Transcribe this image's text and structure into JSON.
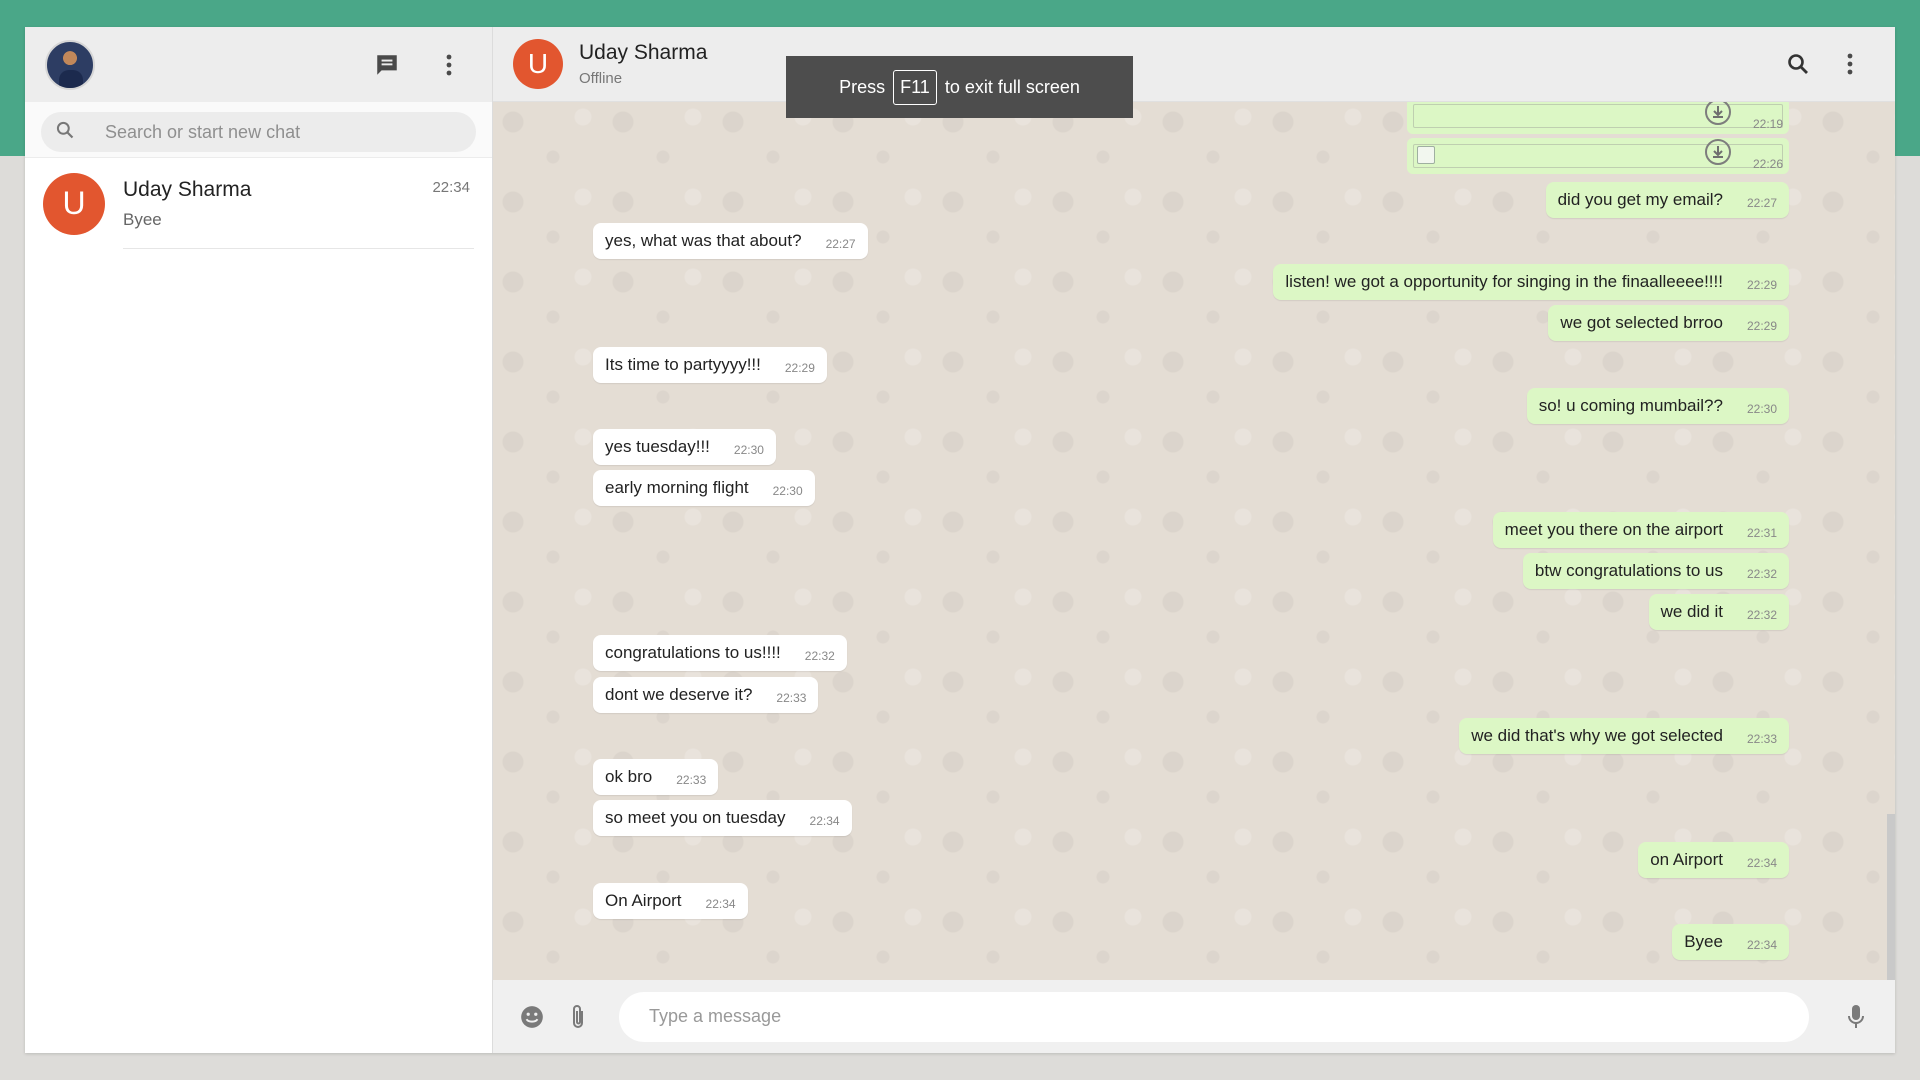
{
  "sidebar": {
    "search_placeholder": "Search or start new chat",
    "chats": [
      {
        "initial": "U",
        "name": "Uday Sharma",
        "last_message": "Byee",
        "time": "22:34"
      }
    ]
  },
  "conversation": {
    "initial": "U",
    "name": "Uday Sharma",
    "status": "Offline",
    "composer_placeholder": "Type a message",
    "files": [
      {
        "time": "22:19",
        "has_image": false
      },
      {
        "time": "22:26",
        "has_image": true
      }
    ],
    "messages": [
      {
        "dir": "out",
        "text": "did you get my email?",
        "time": "22:27"
      },
      {
        "dir": "in",
        "text": "yes, what was that about?",
        "time": "22:27"
      },
      {
        "dir": "out",
        "text": "listen! we got a opportunity for singing in the finaalleeee!!!!",
        "time": "22:29"
      },
      {
        "dir": "out",
        "text": "we got selected brroo",
        "time": "22:29"
      },
      {
        "dir": "in",
        "text": "Its time to partyyyy!!!",
        "time": "22:29"
      },
      {
        "dir": "out",
        "text": "so! u coming mumbail??",
        "time": "22:30"
      },
      {
        "dir": "in",
        "text": "yes tuesday!!!",
        "time": "22:30"
      },
      {
        "dir": "in",
        "text": "early morning flight",
        "time": "22:30"
      },
      {
        "dir": "out",
        "text": "meet you there on the airport",
        "time": "22:31"
      },
      {
        "dir": "out",
        "text": "btw congratulations to us",
        "time": "22:32"
      },
      {
        "dir": "out",
        "text": "we did it",
        "time": "22:32"
      },
      {
        "dir": "in",
        "text": "congratulations to us!!!!",
        "time": "22:32"
      },
      {
        "dir": "in",
        "text": "dont we deserve it?",
        "time": "22:33"
      },
      {
        "dir": "out",
        "text": "we did that's why we got selected",
        "time": "22:33"
      },
      {
        "dir": "in",
        "text": "ok bro",
        "time": "22:33"
      },
      {
        "dir": "in",
        "text": "so meet you on tuesday",
        "time": "22:34"
      },
      {
        "dir": "out",
        "text": "on Airport",
        "time": "22:34"
      },
      {
        "dir": "in",
        "text": "On Airport",
        "time": "22:34"
      },
      {
        "dir": "out",
        "text": "Byee",
        "time": "22:34"
      }
    ]
  },
  "toast": {
    "press": "Press",
    "key": "F11",
    "rest": "to exit full screen"
  },
  "icons": {
    "new_chat": "message-icon",
    "menu": "more-vert-icon",
    "search": "search-icon",
    "emoji": "emoji-icon",
    "attach": "attach-icon",
    "mic": "mic-icon",
    "download": "download-icon"
  },
  "colors": {
    "brand": "#4aa788",
    "avatar": "#e2562f",
    "outgoing": "#dcf7c5",
    "incoming": "#ffffff"
  }
}
